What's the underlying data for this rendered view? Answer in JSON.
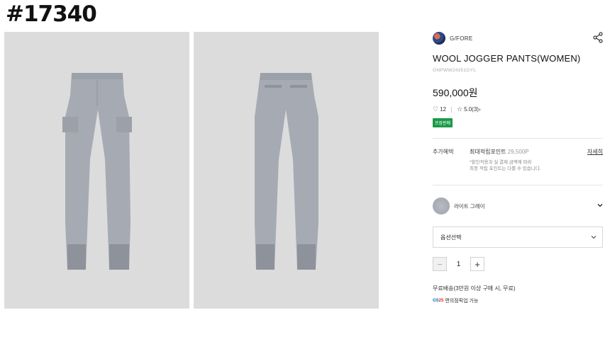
{
  "watermark": "#17340",
  "product": {
    "brand": "G/FORE",
    "title": "WOOL JOGGER PANTS(WOMEN)",
    "code": "GNPWW24351GYL",
    "price": "590,000원",
    "likes": "12",
    "rating": "5.0(3)",
    "rating_arrow": "›",
    "badge": "프장판매"
  },
  "benefit": {
    "label": "추가혜택",
    "points_label": "최대적립포인트",
    "points_value": "29,500P",
    "more": "자세히",
    "note_line1": "*할인적용과 실 결제 금액에 따라",
    "note_line2": "최종 적립 포인트는 다를 수 있습니다."
  },
  "color": {
    "name": "라이트 그레이"
  },
  "option": {
    "placeholder": "옵션선택"
  },
  "quantity": {
    "minus": "−",
    "value": "1",
    "plus": "+"
  },
  "shipping": {
    "text": "무료배송(3만원 이상 구매 시, 무료)"
  },
  "pickup": {
    "brand_gs": "GS",
    "brand_num": "25",
    "text": "편의점픽업 가능"
  },
  "icons": {
    "share": "share-icon",
    "heart": "heart-icon",
    "star": "star-icon",
    "chevron": "chevron-down-icon"
  },
  "colors": {
    "badge_green": "#1c9a48",
    "photo_bg": "#dcdcdc",
    "pants_gray": "#a6abb3"
  }
}
